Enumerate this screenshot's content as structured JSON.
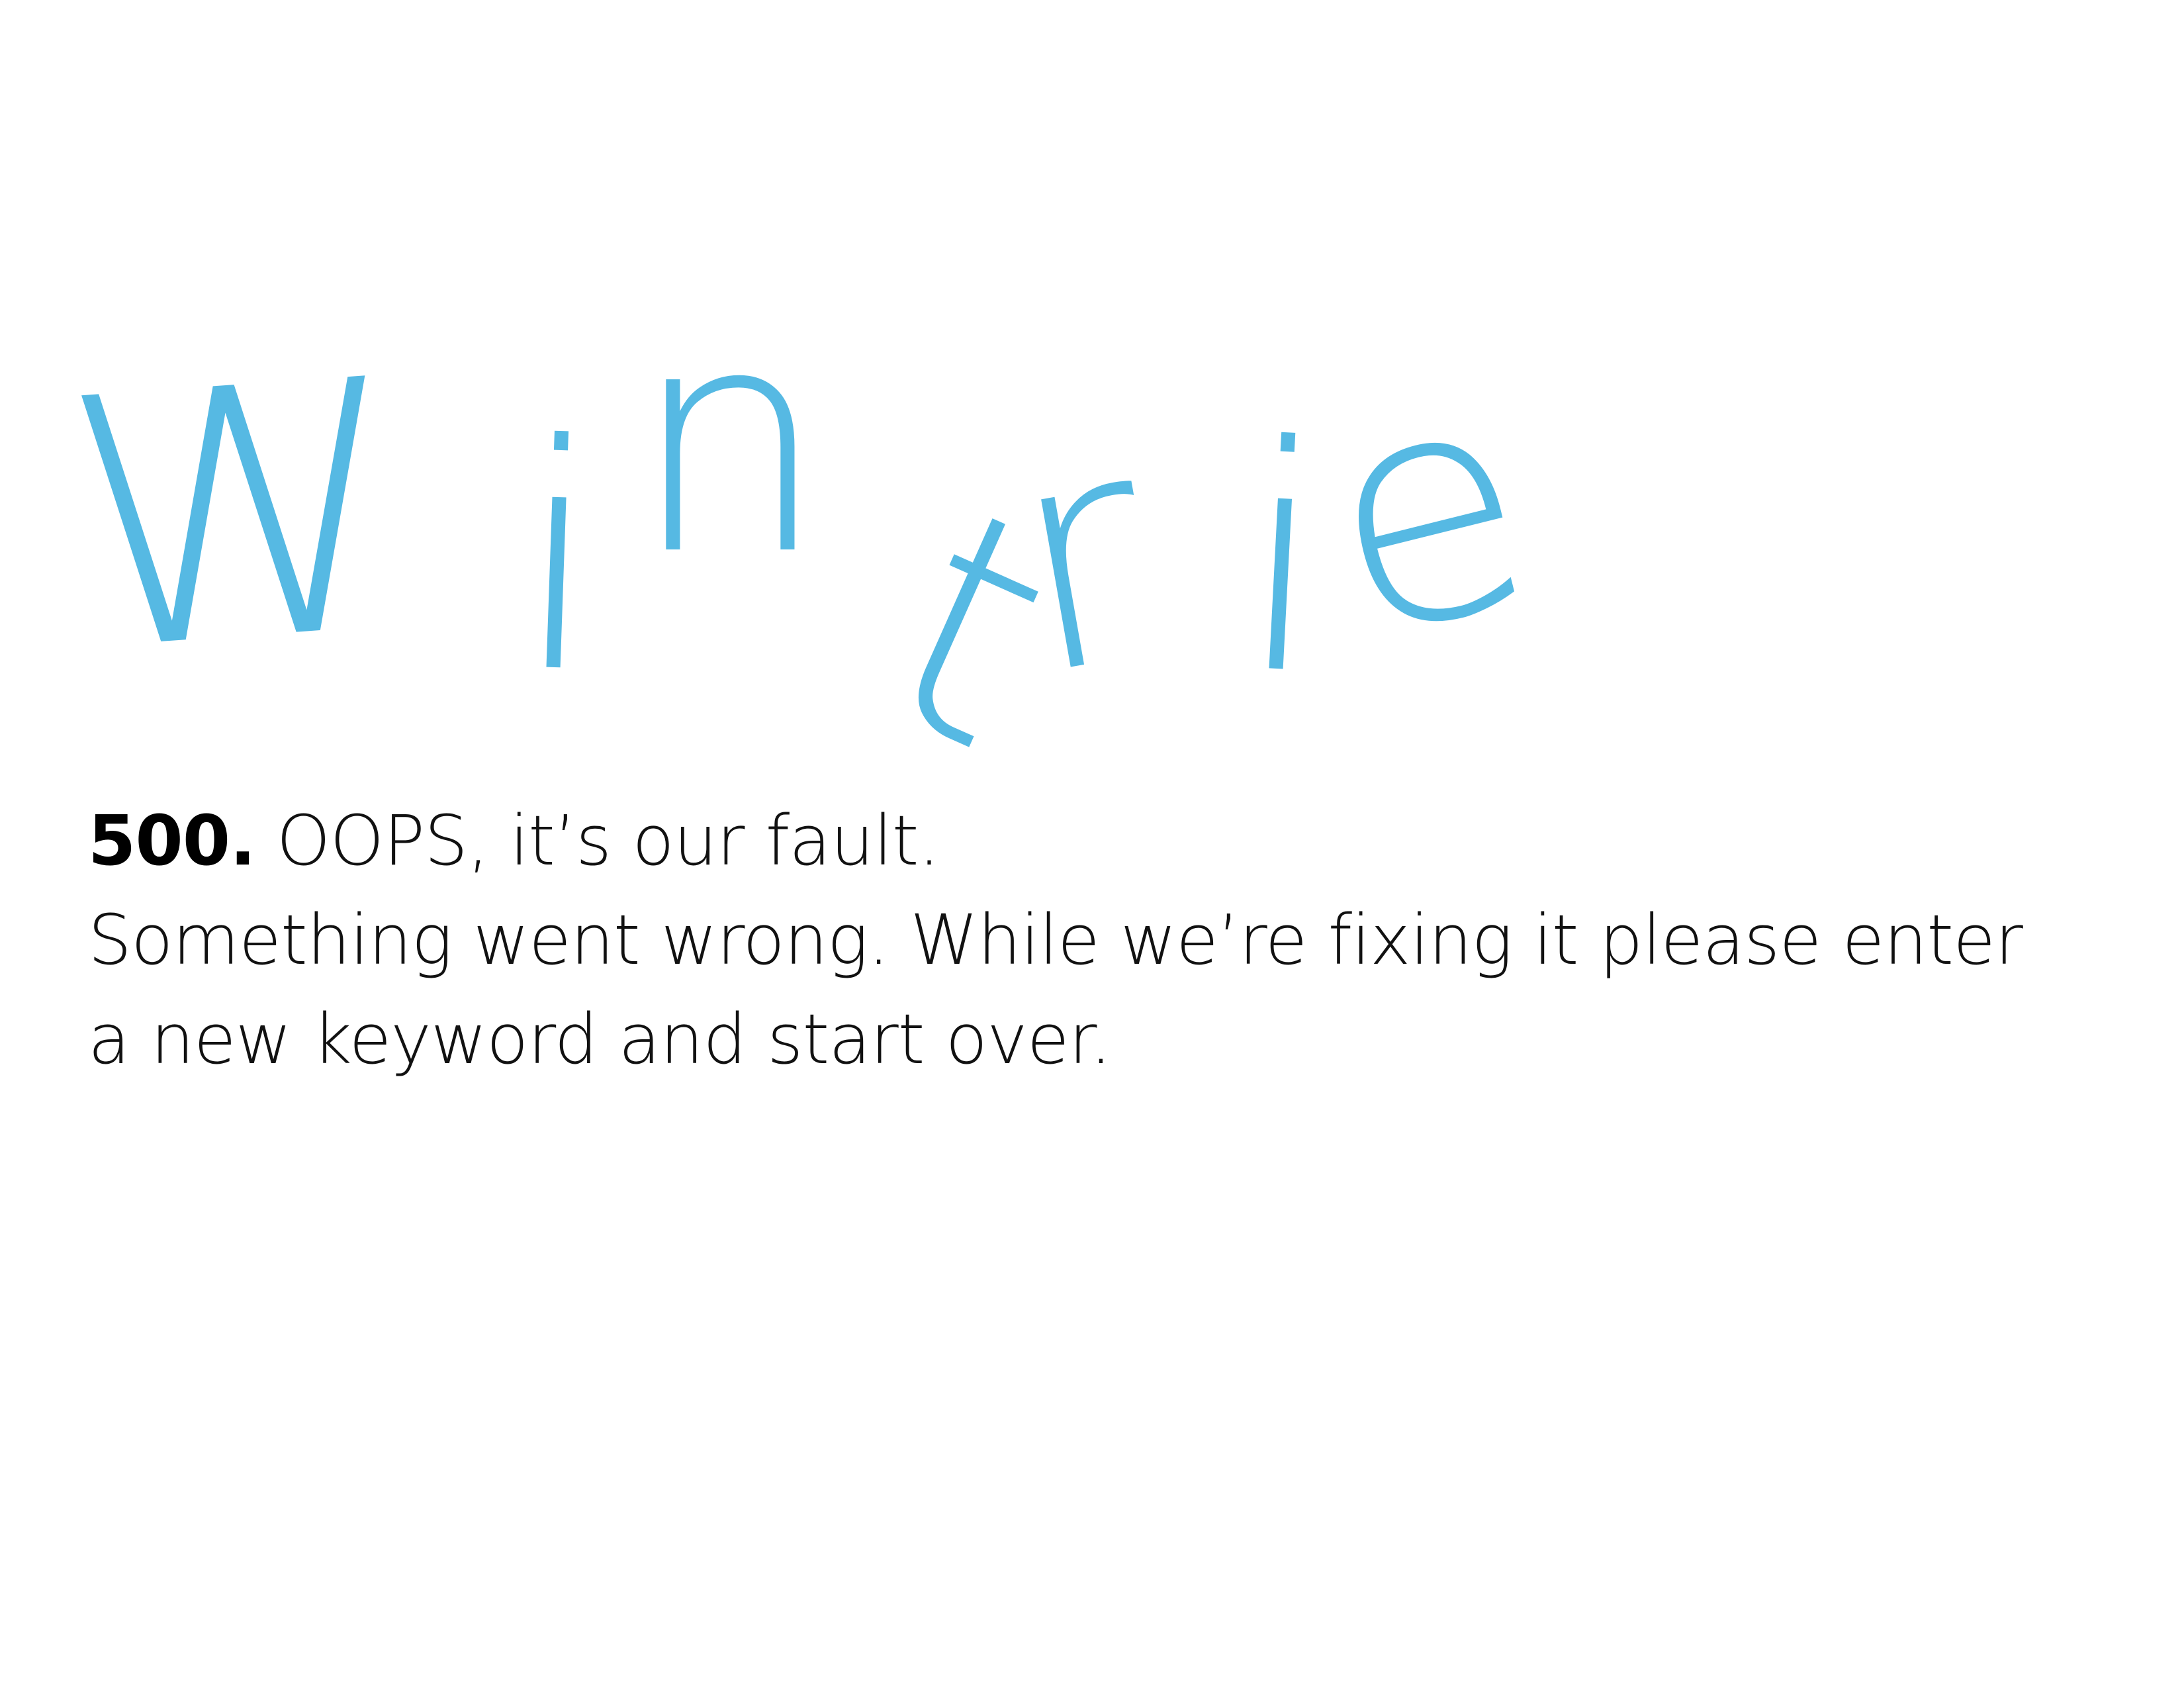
{
  "logo": {
    "text": "Wintrie",
    "letters": [
      "W",
      "i",
      "n",
      "t",
      "r",
      "i",
      "e"
    ],
    "color": "#56b9e3"
  },
  "error": {
    "code": "500.",
    "headline": " OOPS, it’s our fault.",
    "line2": "Something went wrong. While we’re fixing it please enter",
    "line3": "a new keyword and start over.",
    "text_color": "#111111"
  }
}
